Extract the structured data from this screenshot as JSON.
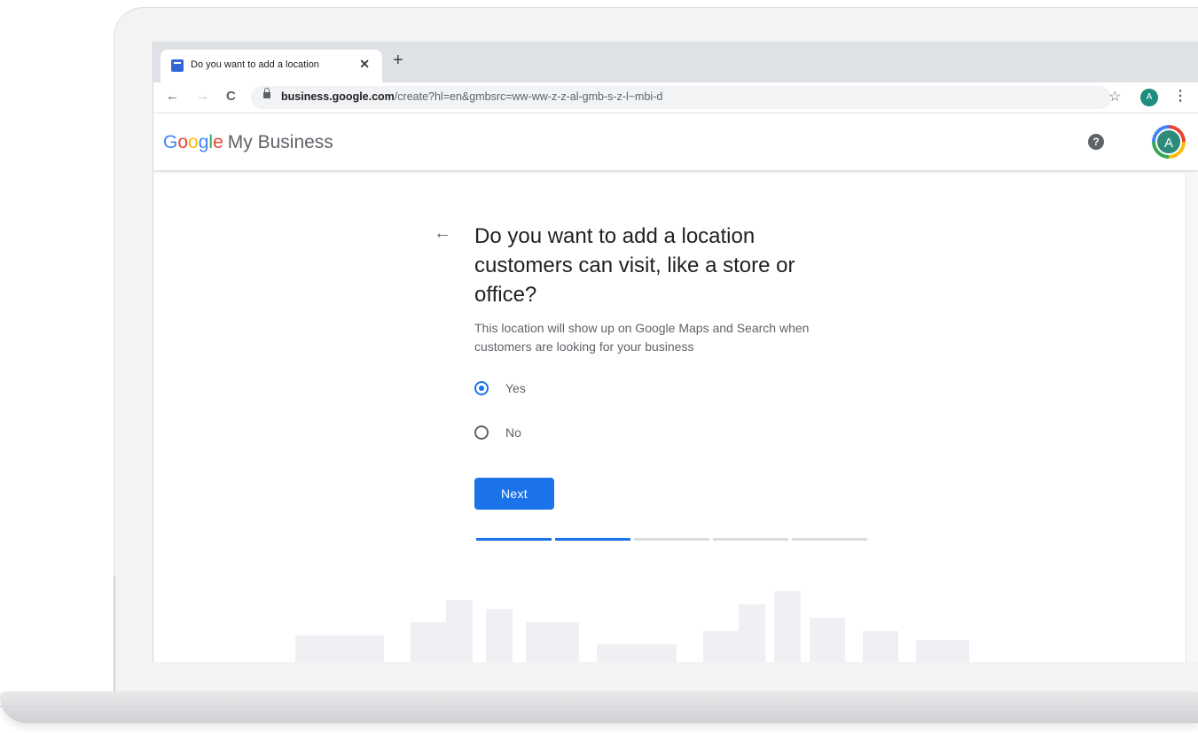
{
  "browser": {
    "tab_title": "Do you want to add a location",
    "tab_close": "✕",
    "new_tab": "+",
    "url_host": "business.google.com",
    "url_path": "/create?hl=en&gmbsrc=ww-ww-z-z-al-gmb-s-z-l~mbi-d",
    "profile_initial": "A",
    "back": "←",
    "forward": "→",
    "reload": "C",
    "star": "☆",
    "menu": "⋮"
  },
  "app": {
    "logo_word": [
      "G",
      "o",
      "o",
      "g",
      "l",
      "e"
    ],
    "product_name": "My Business",
    "help": "?",
    "avatar_initial": "A",
    "colors": {
      "google_blue": "#4285f4",
      "google_red": "#ea4335",
      "google_yellow": "#fbbc05",
      "google_green": "#34a853",
      "primary": "#1a73e8"
    }
  },
  "form": {
    "back": "←",
    "heading": "Do you want to add a location customers can visit, like a store or office?",
    "description": "This location will show up on Google Maps and Search when customers are looking for your business",
    "options": [
      {
        "label": "Yes",
        "selected": true
      },
      {
        "label": "No",
        "selected": false
      }
    ],
    "next_label": "Next",
    "progress": {
      "completed": 2,
      "total": 5
    }
  }
}
